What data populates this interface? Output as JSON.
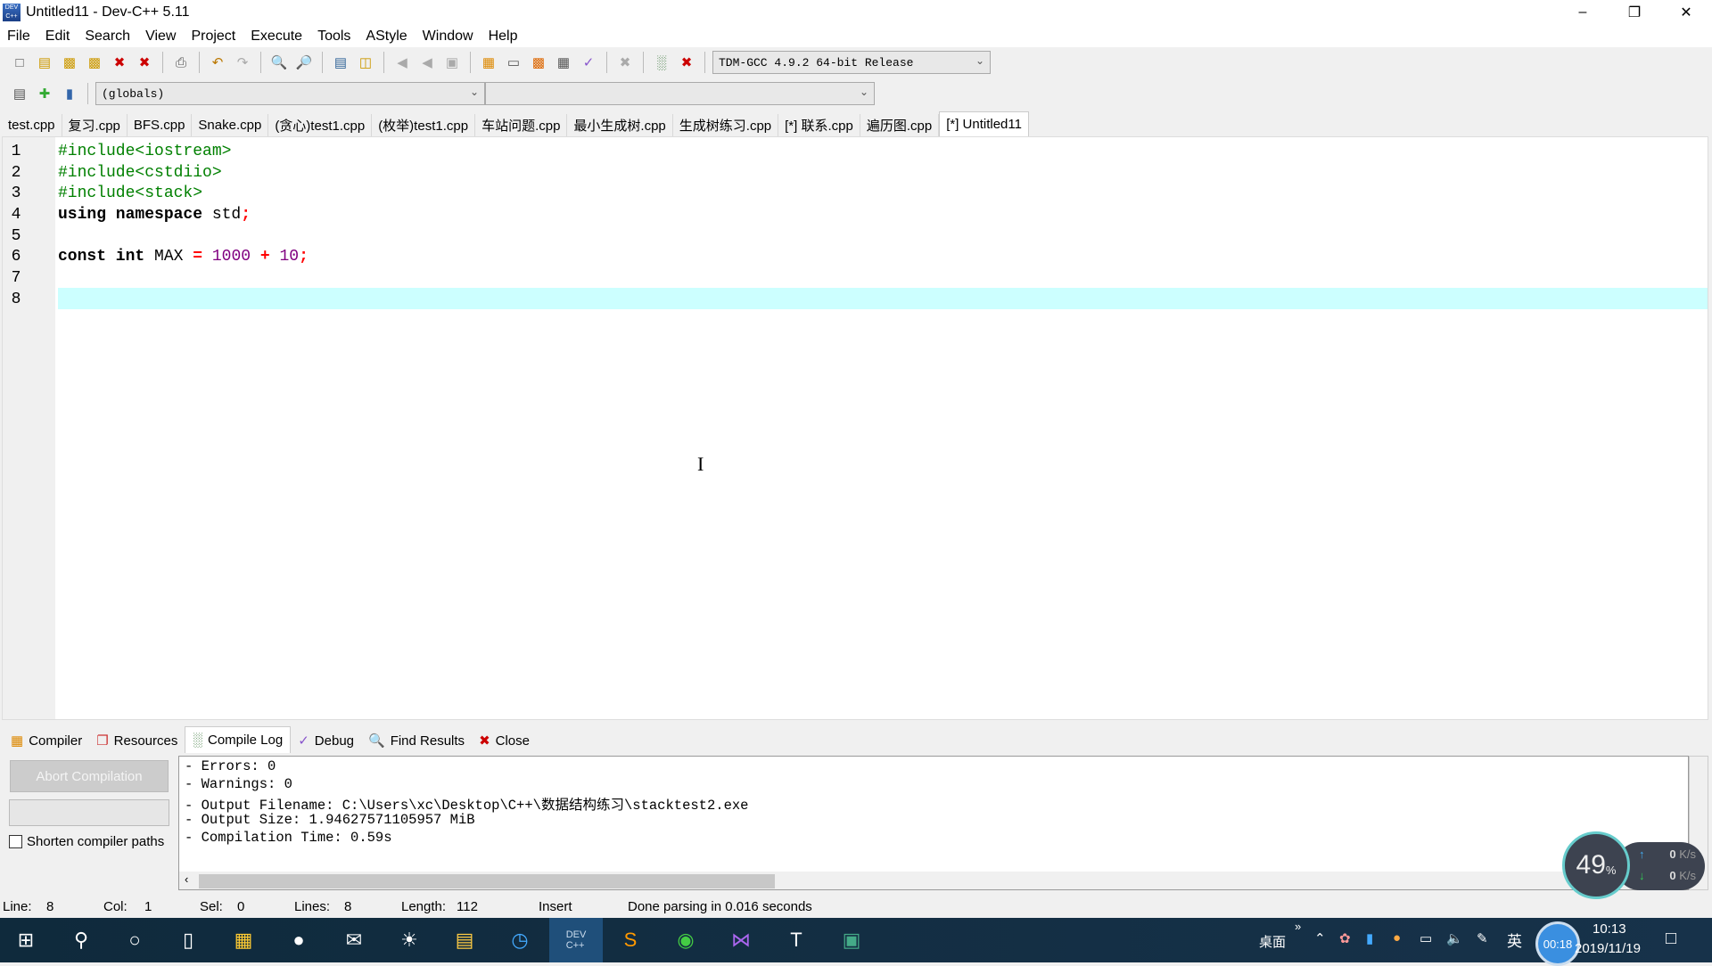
{
  "window": {
    "title": "Untitled11 - Dev-C++ 5.11",
    "app_icon_text": "DEV C++"
  },
  "menu": [
    "File",
    "Edit",
    "Search",
    "View",
    "Project",
    "Execute",
    "Tools",
    "AStyle",
    "Window",
    "Help"
  ],
  "toolbar": {
    "compiler_select": "TDM-GCC 4.9.2 64-bit Release",
    "scope_select": "(globals)",
    "member_select": ""
  },
  "file_tabs": [
    "test.cpp",
    "复习.cpp",
    "BFS.cpp",
    "Snake.cpp",
    "(贪心)test1.cpp",
    "(枚举)test1.cpp",
    "车站问题.cpp",
    "最小生成树.cpp",
    "生成树练习.cpp",
    "[*] 联系.cpp",
    "遍历图.cpp",
    "[*] Untitled11"
  ],
  "active_tab": 11,
  "editor": {
    "line_numbers": [
      "1",
      "2",
      "3",
      "4",
      "5",
      "6",
      "7",
      "8"
    ],
    "lines": {
      "l1": "#include<iostream>",
      "l2": "#include<cstdiio>",
      "l3": "#include<stack>",
      "l4_kw": "using namespace",
      "l4_rest": " std",
      "l4_semi": ";",
      "l6_kw": "const int",
      "l6_name": " MAX ",
      "l6_eq": "=",
      "l6_n1": " 1000 ",
      "l6_plus": "+",
      "l6_n2": " 10",
      "l6_semi": ";"
    },
    "current_line": 8,
    "highlight_color": "#ccffff"
  },
  "bottom_tabs": [
    "Compiler",
    "Resources",
    "Compile Log",
    "Debug",
    "Find Results",
    "Close"
  ],
  "active_bottom_tab": 2,
  "compile_panel": {
    "abort_button": "Abort Compilation",
    "shorten_paths_label": "Shorten compiler paths",
    "shorten_paths_checked": false
  },
  "compile_log": [
    "- Errors: 0",
    "- Warnings: 0",
    "- Output Filename: C:\\Users\\xc\\Desktop\\C++\\数据结构练习\\stacktest2.exe",
    "- Output Size: 1.94627571105957 MiB",
    "- Compilation Time: 0.59s"
  ],
  "status": {
    "line_label": "Line:",
    "line": "8",
    "col_label": "Col:",
    "col": "1",
    "sel_label": "Sel:",
    "sel": "0",
    "lines_label": "Lines:",
    "lines": "8",
    "length_label": "Length:",
    "length": "112",
    "mode": "Insert",
    "message": "Done parsing in 0.016 seconds"
  },
  "widget": {
    "cpu": "49",
    "cpu_unit": "%",
    "up": "0",
    "down": "0",
    "rate_unit": "K/s"
  },
  "taskbar": {
    "desktop_label": "桌面",
    "ime": "英",
    "timer": "00:18",
    "time": "10:13",
    "date": "2019/11/19"
  }
}
